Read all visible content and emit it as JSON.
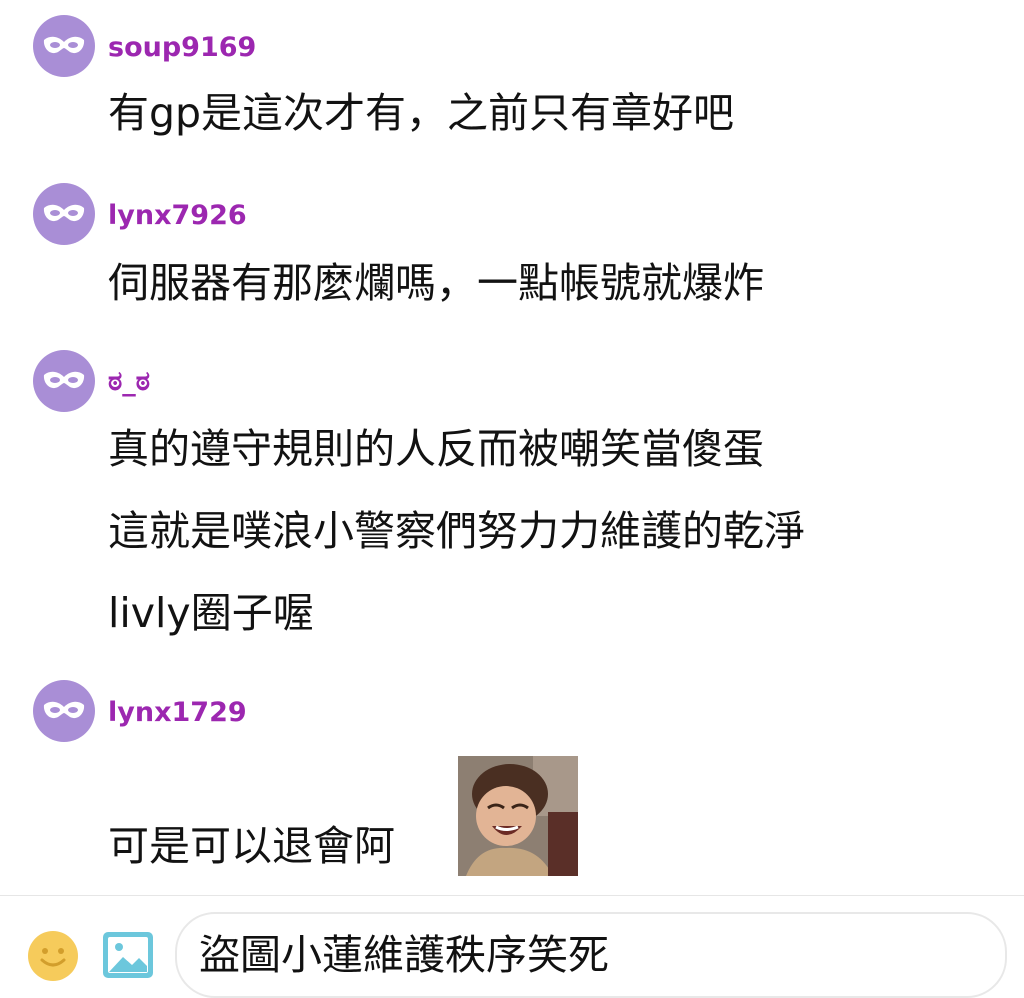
{
  "comments": [
    {
      "username": "soup9169",
      "lines": [
        "有gp是這次才有，之前只有章好吧"
      ]
    },
    {
      "username": "lynx7926",
      "lines": [
        "伺服器有那麼爛嗎，一點帳號就爆炸"
      ]
    },
    {
      "username": "ಠ_ಠ",
      "lines": [
        "真的遵守規則的人反而被嘲笑當傻蛋",
        "這就是噗浪小警察們努力力維護的乾淨",
        "livly圈子喔"
      ]
    },
    {
      "username": "lynx1729",
      "lines": [
        "可是可以退會阿"
      ],
      "has_sticker": true
    }
  ],
  "composer": {
    "input_value": "盜圖小蓮維護秩序笑死",
    "emoji_icon": "smiley-face-icon",
    "image_icon": "image-picker-icon"
  },
  "colors": {
    "avatar_bg": "#a98ed6",
    "username": "#9c27b0",
    "emoji": "#f6cb5b",
    "image_icon": "#6cc7dc"
  }
}
